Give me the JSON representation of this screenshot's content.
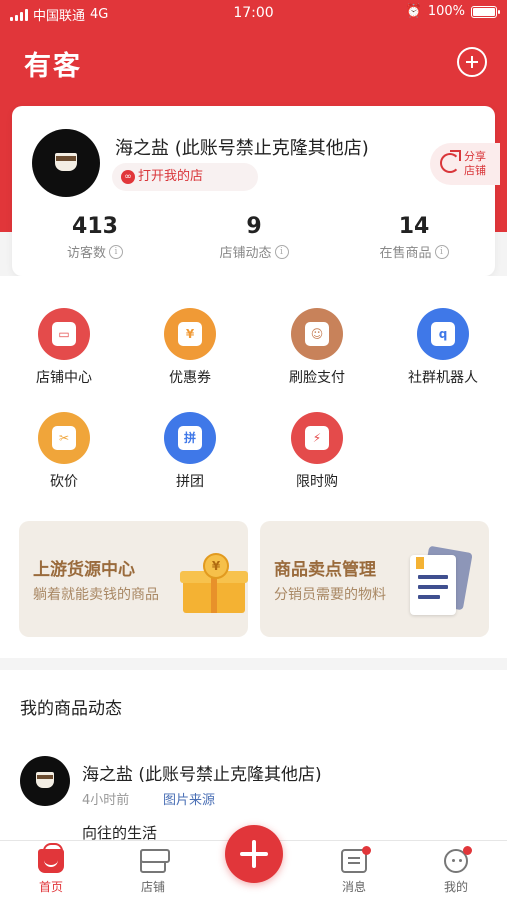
{
  "status_bar": {
    "carrier": "中国联通",
    "network": "4G",
    "time": "17:00",
    "battery": "100%"
  },
  "header": {
    "app_title": "有客"
  },
  "shop": {
    "name": "海之盐 (此账号禁止克隆其他店)",
    "open_shop_label": "打开我的店",
    "share_label": "分享 店铺"
  },
  "stats": [
    {
      "value": "413",
      "label": "访客数"
    },
    {
      "value": "9",
      "label": "店铺动态"
    },
    {
      "value": "14",
      "label": "在售商品"
    }
  ],
  "features": [
    {
      "label": "店铺中心",
      "icon": "store-icon",
      "color": "#e44b4b"
    },
    {
      "label": "优惠券",
      "icon": "coupon-icon",
      "color": "#f09a36"
    },
    {
      "label": "刷脸支付",
      "icon": "face-pay-icon",
      "color": "#c8825a"
    },
    {
      "label": "社群机器人",
      "icon": "robot-icon",
      "color": "#3f78e8"
    },
    {
      "label": "砍价",
      "icon": "bargain-icon",
      "color": "#f0a53a"
    },
    {
      "label": "拼团",
      "icon": "group-buy-icon",
      "color": "#3f78e8"
    },
    {
      "label": "限时购",
      "icon": "flash-sale-icon",
      "color": "#e44b4b"
    }
  ],
  "promos": [
    {
      "title": "上游货源中心",
      "subtitle": "躺着就能卖钱的商品"
    },
    {
      "title": "商品卖点管理",
      "subtitle": "分销员需要的物料"
    }
  ],
  "feed": {
    "title": "我的商品动态",
    "item": {
      "name": "海之盐 (此账号禁止克隆其他店)",
      "time": "4小时前",
      "source": "图片来源",
      "text": "向往的生活"
    }
  },
  "tabbar": {
    "home": "首页",
    "store": "店铺",
    "messages": "消息",
    "me": "我的"
  },
  "colors": {
    "brand": "#e1363a"
  }
}
